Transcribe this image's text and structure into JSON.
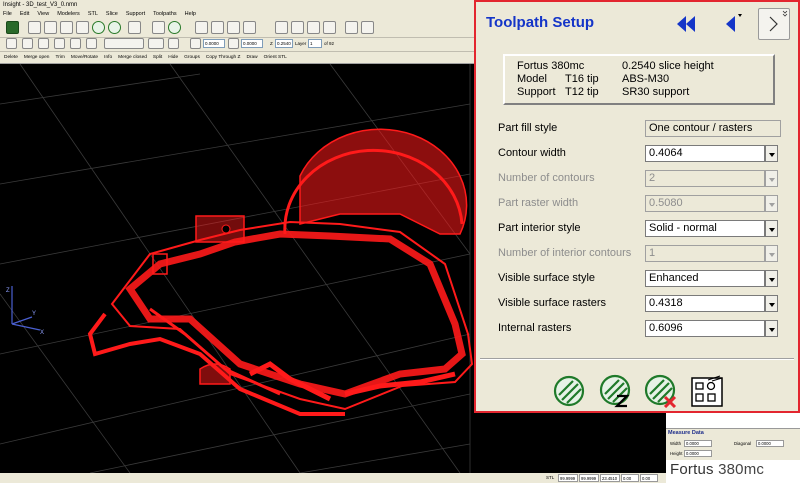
{
  "window": {
    "title": "Insight - 3D_test_V3_0.nmn"
  },
  "menu": [
    "File",
    "Edit",
    "View",
    "Modelers",
    "STL",
    "Slice",
    "Support",
    "Toolpaths",
    "Help"
  ],
  "toolbar2": {
    "field1": "0.0000",
    "field2": "0.0000",
    "z_label": "Z",
    "z_value": "0.2540",
    "layer_label": "Layer",
    "layer_value": "1",
    "of_label": "of 92"
  },
  "toolbar3": [
    "Delete",
    "Merge open",
    "Trim",
    "Move/Rotate",
    "Info",
    "Merge closed",
    "Split",
    "Hide",
    "Groups",
    "Copy Through Z",
    "Draw",
    "Orient STL"
  ],
  "viewport": {
    "axis_x": "X",
    "axis_y": "Y",
    "axis_z": "Z"
  },
  "statusbar": {
    "stl_label": "STL",
    "values": [
      "99.9999",
      "99.9999",
      "23.4510",
      "0.00",
      "0.00"
    ]
  },
  "measure": {
    "title": "Measure Data",
    "width_label": "Width",
    "width_value": "0.0000",
    "diagonal_label": "Diagonal",
    "diagonal_value": "0.0000",
    "height_label": "Height",
    "height_value": "0.0000"
  },
  "brand": {
    "name": "Fortus",
    "model": "380mc"
  },
  "dialog": {
    "title": "Toolpath Setup",
    "info": {
      "machine": "Fortus 380mc",
      "slice_height": "0.2540 slice height",
      "model_label": "Model",
      "model_tip": "T16 tip",
      "model_material": "ABS-M30",
      "support_label": "Support",
      "support_tip": "T12 tip",
      "support_material": "SR30 support"
    },
    "params": [
      {
        "label": "Part fill style",
        "value": "One contour / rasters",
        "enabled": true,
        "readonly": true
      },
      {
        "label": "Contour width",
        "value": "0.4064",
        "enabled": true
      },
      {
        "label": "Number of contours",
        "value": "2",
        "enabled": false
      },
      {
        "label": "Part raster width",
        "value": "0.5080",
        "enabled": false
      },
      {
        "label": "Part interior style",
        "value": "Solid - normal",
        "enabled": true
      },
      {
        "label": "Number of interior contours",
        "value": "1",
        "enabled": false
      },
      {
        "label": "Visible surface style",
        "value": "Enhanced",
        "enabled": true
      },
      {
        "label": "Visible surface rasters",
        "value": "0.4318",
        "enabled": true
      },
      {
        "label": "Internal rasters",
        "value": "0.6096",
        "enabled": true
      }
    ],
    "accent_color": "#e3262f",
    "title_color": "#1435c8"
  }
}
